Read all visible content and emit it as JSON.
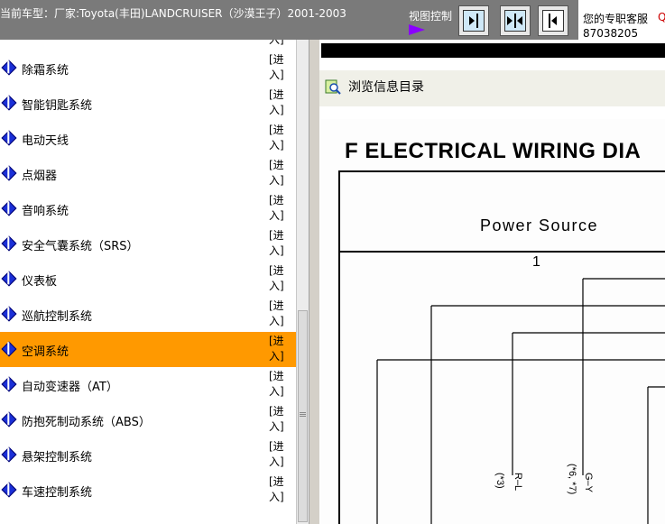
{
  "header": {
    "car_model": "当前车型：厂家:Toyota(丰田)LANDCRUISER（沙漠王子）2001-2003",
    "view_control_label": "视图控制",
    "support_label": "您的专职客服",
    "support_number": "87038205",
    "support_extra": "Q"
  },
  "left_list": {
    "top_fragment": "入]",
    "items": [
      {
        "label": "除霜系统",
        "enter": "[进入]"
      },
      {
        "label": "智能钥匙系统",
        "enter": "[进入]"
      },
      {
        "label": "电动天线",
        "enter": "[进入]"
      },
      {
        "label": "点烟器",
        "enter": "[进入]"
      },
      {
        "label": "音响系统",
        "enter": "[进入]"
      },
      {
        "label": "安全气囊系统（SRS）",
        "enter": "[进入]"
      },
      {
        "label": "仪表板",
        "enter": "[进入]"
      },
      {
        "label": "巡航控制系统",
        "enter": "[进入]"
      },
      {
        "label": "空调系统",
        "enter": "[进入]",
        "selected": true
      },
      {
        "label": "自动变速器（AT）",
        "enter": "[进入]"
      },
      {
        "label": "防抱死制动系统（ABS）",
        "enter": "[进入]"
      },
      {
        "label": "悬架控制系统",
        "enter": "[进入]"
      },
      {
        "label": "车速控制系统",
        "enter": "[进入]"
      }
    ]
  },
  "right_pane": {
    "browse_label": "浏览信息目录",
    "diagram": {
      "title": "F  ELECTRICAL WIRING DIA",
      "power_source": "Power Source",
      "number": "1",
      "wire_labels": [
        "(*3)",
        "R–L",
        "(*6, *7)",
        "G–Y"
      ]
    }
  },
  "colors": {
    "topbar": "#7a7a7a",
    "selected_row": "#ff9900",
    "item_icon": "#1a2fd6",
    "view_arrow": "#8a00ff"
  }
}
